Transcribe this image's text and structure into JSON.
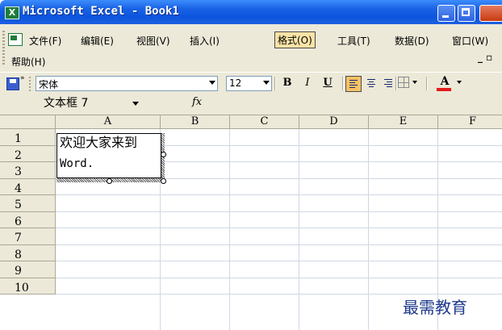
{
  "titlebar": {
    "title": "Microsoft Excel - Book1",
    "app_icon": "X"
  },
  "menu": {
    "items": [
      "文件(F)",
      "编辑(E)",
      "视图(V)",
      "插入(I)",
      "格式(O)",
      "工具(T)",
      "数据(D)",
      "窗口(W)"
    ],
    "help": "帮助(H)",
    "selected": "格式(O)",
    "doc_controls": "_ ▫"
  },
  "toolbar": {
    "font": "宋体",
    "size": "12",
    "bold_label": "B",
    "italic_label": "I",
    "underline_label": "U",
    "font_color_label": "A",
    "font_color": "#e31b1b",
    "more_arrows": "»"
  },
  "formula": {
    "name_box": "文本框 7",
    "fx": "fx"
  },
  "grid": {
    "columns": [
      "A",
      "B",
      "C",
      "D",
      "E",
      "F"
    ],
    "rows": [
      "1",
      "2",
      "3",
      "4",
      "5",
      "6",
      "7",
      "8",
      "9",
      "10"
    ]
  },
  "textbox": {
    "line1": "欢迎大家来到",
    "line2": "Word."
  },
  "watermark": "最需教育"
}
